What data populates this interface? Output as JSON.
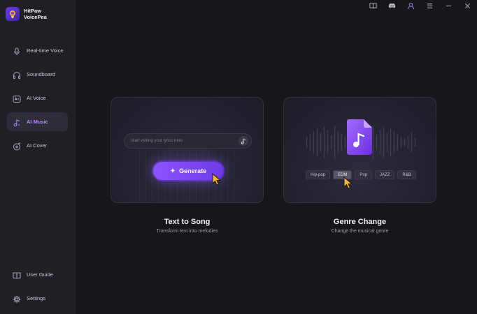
{
  "app": {
    "name_line1": "HitPaw",
    "name_line2": "VoicePea"
  },
  "sidebar": {
    "items": [
      {
        "label": "Real-time Voice",
        "icon": "microphone-icon"
      },
      {
        "label": "Soundboard",
        "icon": "headphones-icon"
      },
      {
        "label": "AI Voice",
        "icon": "ai-voice-icon"
      },
      {
        "label": "AI Music",
        "icon": "music-note-icon",
        "active": true
      },
      {
        "label": "AI Cover",
        "icon": "vinyl-disc-icon"
      }
    ],
    "bottom": [
      {
        "label": "User Guide",
        "icon": "book-icon"
      },
      {
        "label": "Settings",
        "icon": "gear-icon"
      }
    ]
  },
  "topbar": {
    "icons": [
      "book-icon",
      "discord-icon",
      "user-icon",
      "menu-icon",
      "minimize-icon",
      "close-icon"
    ]
  },
  "cards": {
    "text_to_song": {
      "title": "Text to Song",
      "subtitle": "Transform text into melodies",
      "lyrics_placeholder": "Start writing your lyrics here",
      "generate_label": "Generate"
    },
    "genre_change": {
      "title": "Genre Change",
      "subtitle": "Change the musical genre",
      "genres": [
        "Hip-pop",
        "EDM",
        "Pop",
        "JAZZ",
        "R&B"
      ],
      "selected": "EDM"
    }
  },
  "colors": {
    "accent": "#8b55ff",
    "active_text": "#b889ff",
    "background": "#16161b",
    "sidebar": "#1f1f26"
  }
}
